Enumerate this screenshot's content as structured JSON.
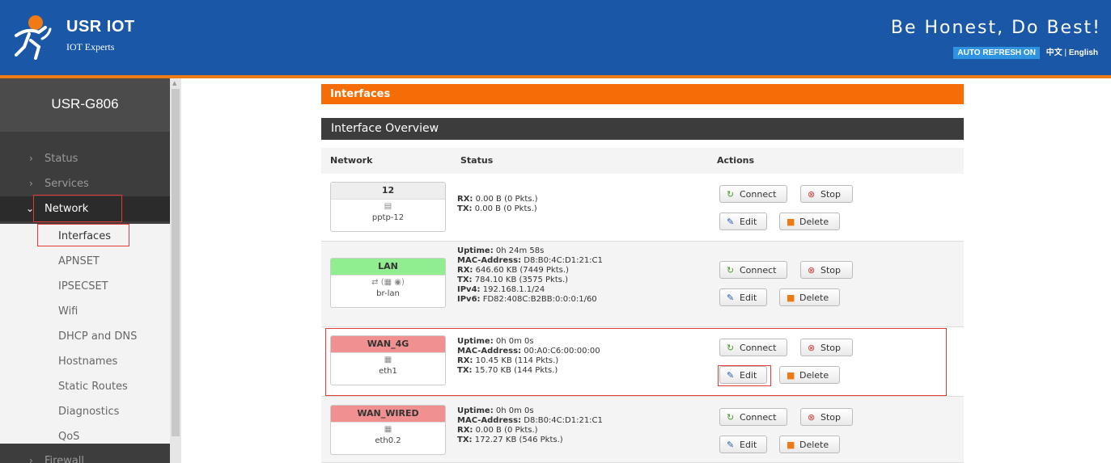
{
  "header": {
    "brand_name": "USR IOT",
    "brand_tag": "IOT Experts",
    "slogan": "Be Honest, Do Best!",
    "auto_refresh": "AUTO REFRESH ON",
    "lang_zh": "中文",
    "lang_sep": "|",
    "lang_en": "English",
    "colors": {
      "header_bg": "#1a57a6",
      "accent": "#f27a14"
    }
  },
  "sidebar": {
    "model": "USR-G806",
    "menu": [
      {
        "label": "Status",
        "expanded": false
      },
      {
        "label": "Services",
        "expanded": false
      },
      {
        "label": "Network",
        "expanded": true
      }
    ],
    "submenu": [
      "Interfaces",
      "APNSET",
      "IPSECSET",
      "Wifi",
      "DHCP and DNS",
      "Hostnames",
      "Static Routes",
      "Diagnostics",
      "QoS"
    ],
    "bottom_item": "Firewall"
  },
  "main": {
    "title": "Interfaces",
    "section": "Interface Overview",
    "columns": [
      "Network",
      "Status",
      "Actions"
    ],
    "actions": {
      "connect": "Connect",
      "stop": "Stop",
      "edit": "Edit",
      "delete": "Delete"
    },
    "rows": [
      {
        "name": "12",
        "device": "pptp-12",
        "name_color": "neutral",
        "status": [
          {
            "k": "RX",
            "v": "0.00 B (0 Pkts.)"
          },
          {
            "k": "TX",
            "v": "0.00 B (0 Pkts.)"
          }
        ]
      },
      {
        "name": "LAN",
        "device": "br-lan",
        "name_color": "green",
        "status": [
          {
            "k": "Uptime",
            "v": "0h 24m 58s"
          },
          {
            "k": "MAC-Address",
            "v": "D8:B0:4C:D1:21:C1"
          },
          {
            "k": "RX",
            "v": "646.60 KB (7449 Pkts.)"
          },
          {
            "k": "TX",
            "v": "784.10 KB (3575 Pkts.)"
          },
          {
            "k": "IPv4",
            "v": "192.168.1.1/24"
          },
          {
            "k": "IPv6",
            "v": "FD82:408C:B2BB:0:0:0:1/60"
          }
        ]
      },
      {
        "name": "WAN_4G",
        "device": "eth1",
        "name_color": "red",
        "status": [
          {
            "k": "Uptime",
            "v": "0h 0m 0s"
          },
          {
            "k": "MAC-Address",
            "v": "00:A0:C6:00:00:00"
          },
          {
            "k": "RX",
            "v": "10.45 KB (114 Pkts.)"
          },
          {
            "k": "TX",
            "v": "15.70 KB (144 Pkts.)"
          }
        ]
      },
      {
        "name": "WAN_WIRED",
        "device": "eth0.2",
        "name_color": "red",
        "status": [
          {
            "k": "Uptime",
            "v": "0h 0m 0s"
          },
          {
            "k": "MAC-Address",
            "v": "D8:B0:4C:D1:21:C1"
          },
          {
            "k": "RX",
            "v": "0.00 B (0 Pkts.)"
          },
          {
            "k": "TX",
            "v": "172.27 KB (546 Pkts.)"
          }
        ]
      }
    ]
  }
}
